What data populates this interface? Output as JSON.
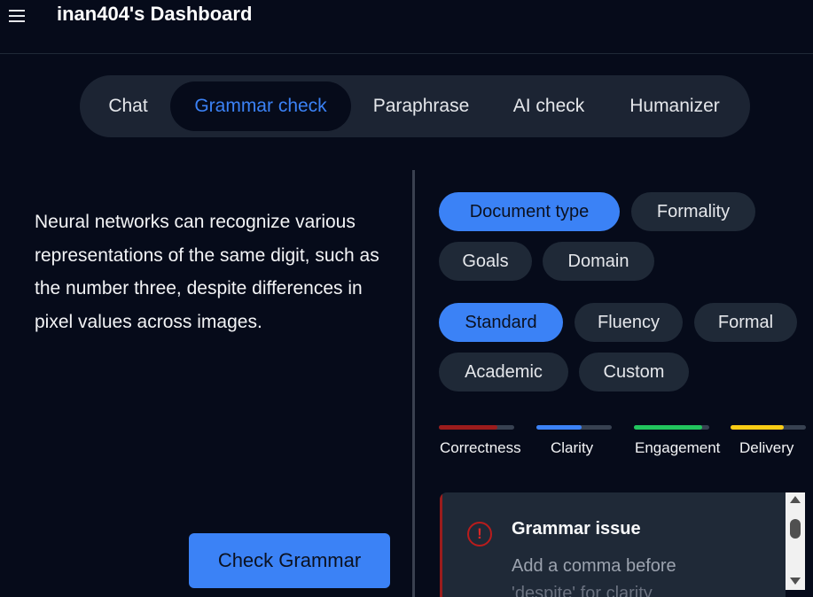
{
  "header": {
    "title": "inan404's Dashboard",
    "menu_icon": "hamburger-menu-icon"
  },
  "tabs": [
    {
      "label": "Chat",
      "active": false
    },
    {
      "label": "Grammar check",
      "active": true
    },
    {
      "label": "Paraphrase",
      "active": false
    },
    {
      "label": "AI check",
      "active": false
    },
    {
      "label": "Humanizer",
      "active": false
    }
  ],
  "editor": {
    "text": "Neural networks can recognize various representations of the same digit, such as the number three, despite differences in pixel values across images.",
    "check_button": "Check Grammar"
  },
  "filters": {
    "categories": [
      {
        "label": "Document type",
        "active": true
      },
      {
        "label": "Formality",
        "active": false
      },
      {
        "label": "Goals",
        "active": false
      },
      {
        "label": "Domain",
        "active": false
      }
    ],
    "styles": [
      {
        "label": "Standard",
        "active": true
      },
      {
        "label": "Fluency",
        "active": false
      },
      {
        "label": "Formal",
        "active": false
      },
      {
        "label": "Academic",
        "active": false
      },
      {
        "label": "Custom",
        "active": false
      }
    ]
  },
  "metrics": [
    {
      "label": "Correctness",
      "color": "#9b1c1c",
      "value": 0.78
    },
    {
      "label": "Clarity",
      "color": "#3b82f6",
      "value": 0.6
    },
    {
      "label": "Engagement",
      "color": "#22c55e",
      "value": 0.9
    },
    {
      "label": "Delivery",
      "color": "#facc15",
      "value": 0.7
    }
  ],
  "issue": {
    "icon": "alert-circle-icon",
    "title": "Grammar issue",
    "message": "Add a comma before",
    "message_cont": "'despite' for clarity"
  }
}
